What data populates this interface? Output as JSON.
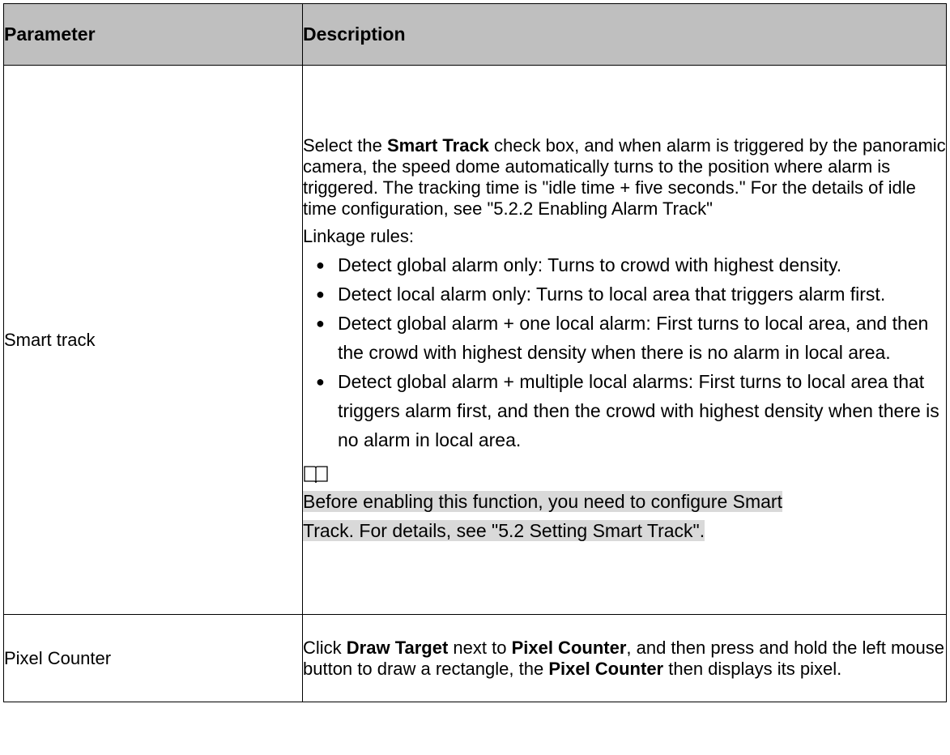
{
  "table": {
    "header": {
      "parameter": "Parameter",
      "description": "Description"
    },
    "rows": [
      {
        "parameter": "Smart track",
        "intro": {
          "pre": "Select the ",
          "bold": "Smart Track",
          "post": " check box, and when alarm is triggered by the panoramic camera, the speed dome automatically turns to the position where alarm is triggered. The tracking time is \"idle time + five seconds.\" For the details of idle time configuration, see \"5.2.2 Enabling Alarm Track\""
        },
        "rules_title": "Linkage rules:",
        "rules": [
          "Detect global alarm only: Turns to crowd with highest density.",
          "Detect local alarm only: Turns to local area that triggers alarm first.",
          "Detect global alarm + one local alarm: First turns to local area, and then the crowd with highest density when there is no alarm in local area.",
          "Detect global alarm + multiple local alarms: First turns to local area that triggers alarm first, and then the crowd with highest density when there is no alarm in local area."
        ],
        "note_icon": "book-icon",
        "note_line1": "Before enabling this function, you need to configure Smart ",
        "note_line2": "Track. For details, see \"5.2 Setting Smart Track\"."
      },
      {
        "parameter": "Pixel Counter",
        "desc": {
          "t1": "Click ",
          "b1": "Draw Target",
          "t2": " next to ",
          "b2": "Pixel Counter",
          "t3": ", and then press and hold the left mouse button to draw a rectangle, the ",
          "b3": "Pixel Counter",
          "t4": " then displays its pixel."
        }
      }
    ]
  }
}
